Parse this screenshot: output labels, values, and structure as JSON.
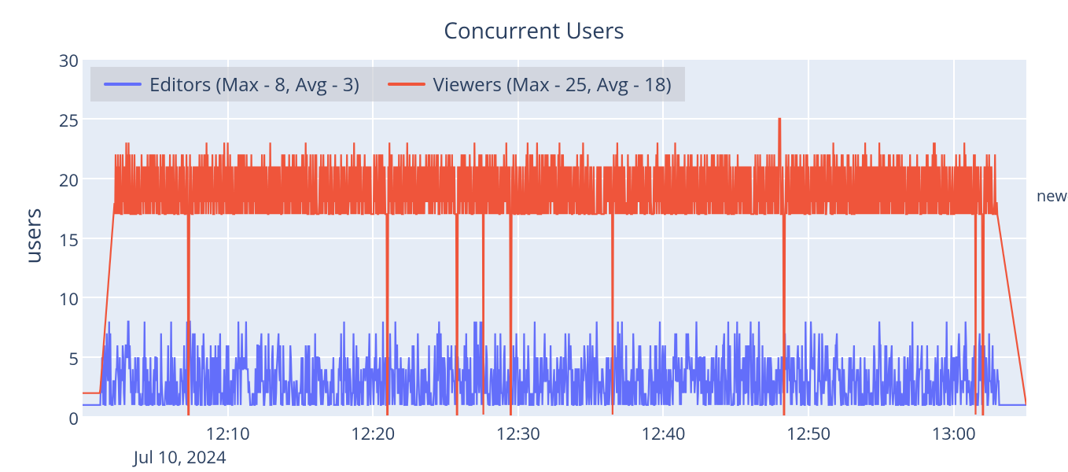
{
  "chart_data": {
    "type": "line",
    "title": "Concurrent Users",
    "ylabel": "users",
    "xlabel": "",
    "date_label": "Jul 10, 2024",
    "ylim": [
      0,
      30
    ],
    "y_ticks": [
      0,
      5,
      10,
      15,
      20,
      25,
      30
    ],
    "x_tick_labels": [
      "12:10",
      "12:20",
      "12:30",
      "12:40",
      "12:50",
      "13:00"
    ],
    "x_range_minutes": [
      0,
      65
    ],
    "x_tick_positions_minutes": [
      10,
      20,
      30,
      40,
      50,
      60
    ],
    "legend_position": "inside-top-left",
    "grid": true,
    "series": [
      {
        "name": "Editors (Max - 8, Avg - 3)",
        "color": "#636efa",
        "max": 8,
        "avg": 3,
        "pattern": "noisy-low",
        "baseline_range": [
          1,
          5
        ],
        "spikes_to": [
          6,
          7,
          8
        ],
        "drops_to_zero_at_minutes": [],
        "start_minute": 1.2,
        "end_minute": 65,
        "end_value": 1
      },
      {
        "name": "Viewers (Max - 25, Avg - 18)",
        "color": "#ef553b",
        "max": 25,
        "avg": 18,
        "pattern": "band-with-drops",
        "baseline_range": [
          17,
          22
        ],
        "initial_value": 2,
        "ramp_start_minute": 1.2,
        "ramp_end_minute": 2.2,
        "drops_to_zero_at_minutes": [
          7.3,
          21.0,
          25.8,
          27.6,
          29.5,
          36.5,
          48.3,
          61.5,
          62.0
        ],
        "peak_25_at_minute": 48.0,
        "end_plateau_minute": 63.0,
        "end_value": 1
      }
    ],
    "right_margin_text": "new-"
  }
}
